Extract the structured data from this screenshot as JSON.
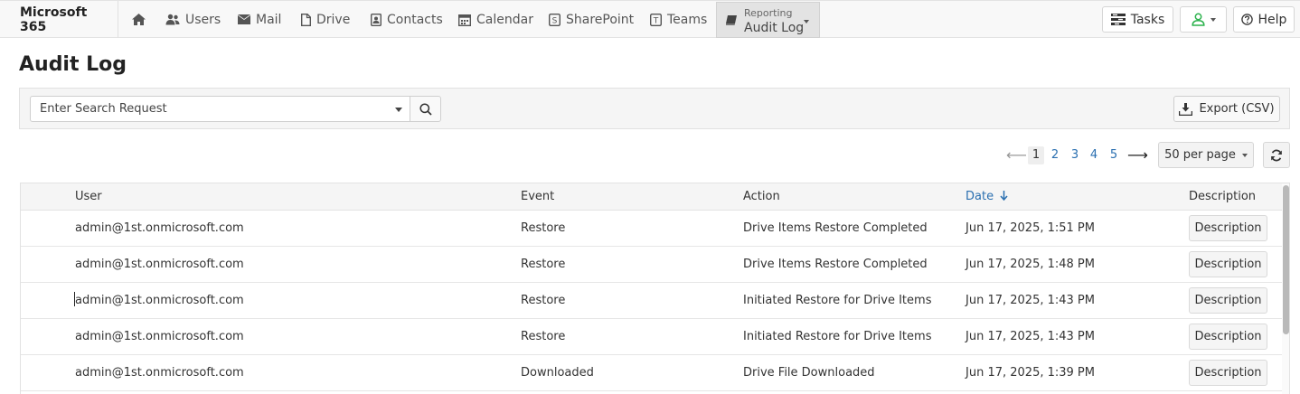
{
  "navbar": {
    "brand": "Microsoft 365",
    "items": [
      {
        "label": "Users",
        "icon": "users-icon"
      },
      {
        "label": "Mail",
        "icon": "mail-icon"
      },
      {
        "label": "Drive",
        "icon": "file-icon"
      },
      {
        "label": "Contacts",
        "icon": "contacts-icon"
      },
      {
        "label": "Calendar",
        "icon": "calendar-icon"
      },
      {
        "label": "SharePoint",
        "icon": "sharepoint-icon"
      },
      {
        "label": "Teams",
        "icon": "teams-icon"
      }
    ],
    "active": {
      "sub": "Reporting",
      "label": "Audit Log",
      "icon": "book-icon"
    },
    "tasks_label": "Tasks",
    "help_label": "Help",
    "accent_user_color": "#2bb24c"
  },
  "page": {
    "title": "Audit Log"
  },
  "search": {
    "placeholder": "Enter Search Request"
  },
  "export_label": "Export (CSV)",
  "pagination": {
    "pages": [
      "1",
      "2",
      "3",
      "4",
      "5"
    ],
    "current": "1",
    "prev": "⟵",
    "next": "⟶",
    "per_page": "50 per page"
  },
  "table": {
    "columns": [
      "User",
      "Event",
      "Action",
      "Date",
      "Description"
    ],
    "sorted_column": "Date",
    "sort_direction": "desc",
    "rows": [
      {
        "user": "admin@1st.onmicrosoft.com",
        "event": "Restore",
        "action": "Drive Items Restore Completed",
        "date": "Jun 17, 2025, 1:51 PM",
        "description": "Description"
      },
      {
        "user": "admin@1st.onmicrosoft.com",
        "event": "Restore",
        "action": "Drive Items Restore Completed",
        "date": "Jun 17, 2025, 1:48 PM",
        "description": "Description"
      },
      {
        "user": "admin@1st.onmicrosoft.com",
        "event": "Restore",
        "action": "Initiated Restore for Drive Items",
        "date": "Jun 17, 2025, 1:43 PM",
        "description": "Description"
      },
      {
        "user": "admin@1st.onmicrosoft.com",
        "event": "Restore",
        "action": "Initiated Restore for Drive Items",
        "date": "Jun 17, 2025, 1:43 PM",
        "description": "Description"
      },
      {
        "user": "admin@1st.onmicrosoft.com",
        "event": "Downloaded",
        "action": "Drive File Downloaded",
        "date": "Jun 17, 2025, 1:39 PM",
        "description": "Description"
      }
    ]
  }
}
